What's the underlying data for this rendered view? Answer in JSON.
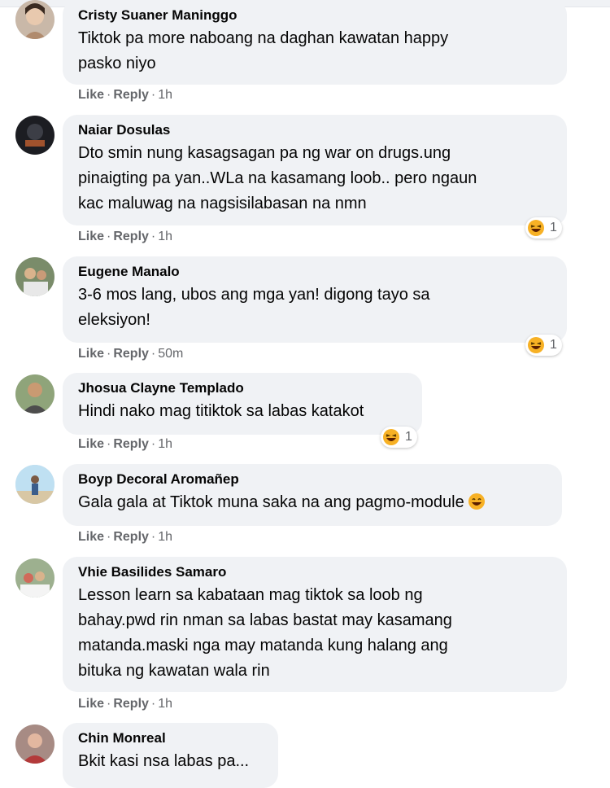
{
  "comments": [
    {
      "name": "Cristy Suaner Maninggo",
      "lines": [
        "Tiktok pa more naboang na daghan kawatan happy",
        "pasko niyo"
      ],
      "like": "Like",
      "reply": "Reply",
      "time": "1h"
    },
    {
      "name": "Naiar Dosulas",
      "lines": [
        "Dto smin nung kasagsagan pa ng war on drugs.ung",
        "pinaigting pa yan..WLa na kasamang loob.. pero ngaun",
        "kac maluwag na nagsisilabasan na nmn"
      ],
      "like": "Like",
      "reply": "Reply",
      "time": "1h",
      "reaction_count": "1"
    },
    {
      "name": "Eugene Manalo",
      "lines": [
        "3-6 mos lang, ubos ang mga yan! digong tayo sa",
        "eleksiyon!"
      ],
      "like": "Like",
      "reply": "Reply",
      "time": "50m",
      "reaction_count": "1"
    },
    {
      "name": "Jhosua Clayne Templado",
      "lines": [
        "Hindi nako mag titiktok sa labas katakot"
      ],
      "like": "Like",
      "reply": "Reply",
      "time": "1h",
      "reaction_count": "1"
    },
    {
      "name": "Boyp Decoral Aromañep",
      "lines": [
        "Gala gala at Tiktok muna saka na ang pagmo-module"
      ],
      "like": "Like",
      "reply": "Reply",
      "time": "1h"
    },
    {
      "name": "Vhie Basilides Samaro",
      "lines": [
        "Lesson learn sa kabataan mag tiktok sa loob ng",
        "bahay.pwd rin nman sa labas bastat may kasamang",
        "matanda.maski nga may matanda kung halang ang",
        "bituka ng kawatan wala rin"
      ],
      "like": "Like",
      "reply": "Reply",
      "time": "1h"
    },
    {
      "name": "Chin Monreal",
      "lines": [
        "Bkit kasi nsa labas pa..."
      ]
    }
  ],
  "icons": {
    "reaction": "laughing-emoji-icon",
    "inline": "grinning-emoji-icon"
  },
  "colors": {
    "bubble": "#f0f2f5",
    "meta": "#65676b",
    "emoji": "#f7b125"
  }
}
